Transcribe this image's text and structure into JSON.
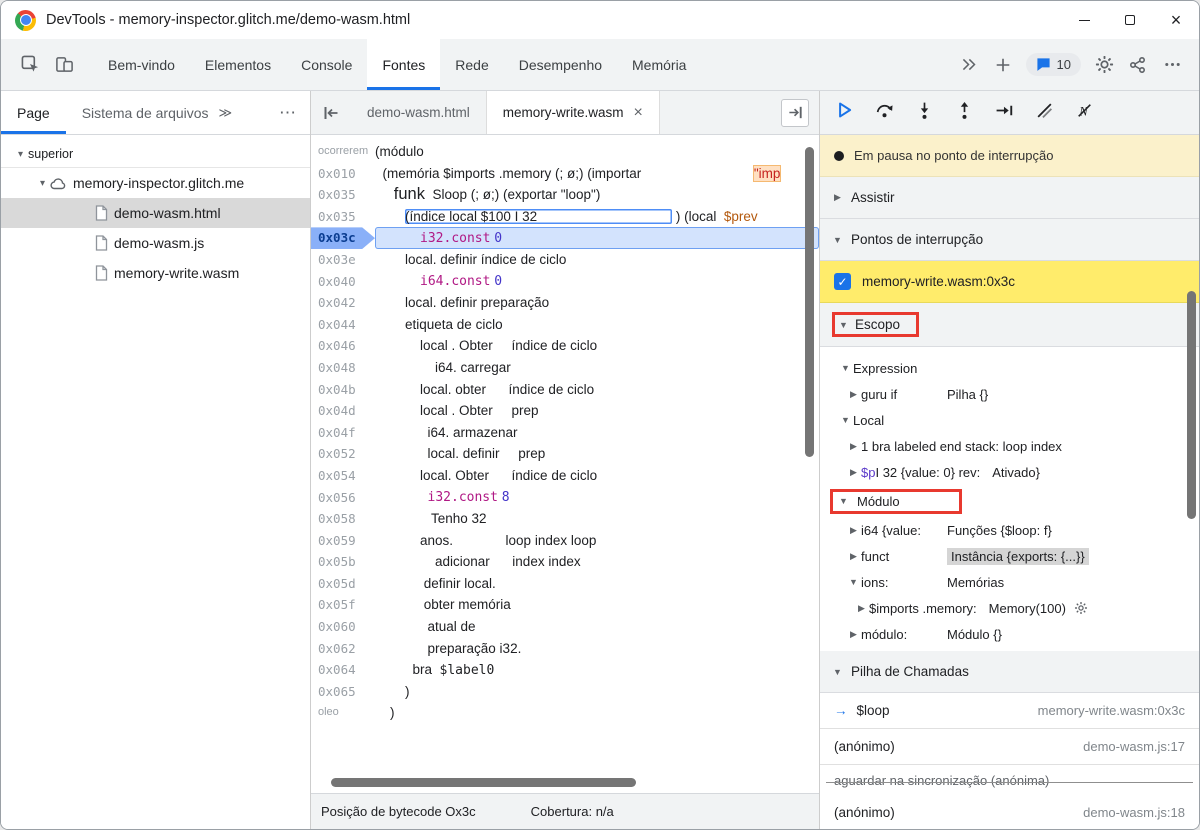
{
  "window": {
    "title": "DevTools - memory-inspector.glitch.me/demo-wasm.html"
  },
  "main_toolbar": {
    "tabs": [
      {
        "label": "Bem-vindo",
        "active": false
      },
      {
        "label": "Elementos",
        "active": false
      },
      {
        "label": "Console",
        "active": false
      },
      {
        "label": "Fontes",
        "active": true
      },
      {
        "label": "Rede",
        "active": false
      },
      {
        "label": "Desempenho",
        "active": false
      },
      {
        "label": "Memória",
        "active": false
      }
    ],
    "more_tabs_glyph": "≫",
    "issues_count": "10",
    "left_icons": [
      "inspect-icon",
      "device-toolbar-icon"
    ],
    "right_icons": [
      "more-tabs-icon",
      "add-tab-icon",
      "issues-icon",
      "settings-icon",
      "profiles-icon",
      "overflow-menu-icon"
    ]
  },
  "left_panel": {
    "tabs": [
      {
        "label": "Page",
        "active": true
      },
      {
        "label": "Sistema de arquivos",
        "active": false
      }
    ],
    "overflow_glyph": "≫",
    "more_glyph": "⋯",
    "tree": [
      {
        "label": "superior",
        "level": 0,
        "expander": "open",
        "icon": null,
        "selected": false
      },
      {
        "label": "memory-inspector.glitch.me",
        "level": 1,
        "expander": "open",
        "icon": "cloud",
        "selected": false
      },
      {
        "label": "demo-wasm.html",
        "level": 2,
        "expander": null,
        "icon": "file",
        "selected": true
      },
      {
        "label": "demo-wasm.js",
        "level": 2,
        "expander": null,
        "icon": "file",
        "selected": false
      },
      {
        "label": "memory-write.wasm",
        "level": 2,
        "expander": null,
        "icon": "file",
        "selected": false
      }
    ]
  },
  "editor": {
    "tabs": [
      {
        "label": "demo-wasm.html",
        "active": false,
        "closable": false
      },
      {
        "label": "memory-write.wasm",
        "active": true,
        "closable": true
      }
    ],
    "status_left": "Posição de bytecode Ox3c",
    "status_right": "Cobertura: n/a",
    "lines": [
      {
        "a": "ocorrerem",
        "seg": [
          [
            "t",
            "(módulo"
          ]
        ]
      },
      {
        "a": "0x010",
        "seg": [
          [
            "t",
            "  (memória $imports .memory (; ø;) (importar"
          ],
          [
            "t",
            "                              "
          ],
          [
            "str",
            "\"imp"
          ]
        ]
      },
      {
        "a": "0x035",
        "seg": [
          [
            "t",
            "     "
          ],
          [
            "big",
            "funk"
          ],
          [
            "t",
            "  Sloop (; ø;) (exportar \"loop\")"
          ]
        ]
      },
      {
        "a": "0x035",
        "seg": [
          [
            "t",
            "        "
          ],
          [
            "boxed",
            "(índice local $100 I 32                                    "
          ],
          [
            "t",
            " ) (local  "
          ],
          [
            "var",
            "$prev"
          ]
        ]
      },
      {
        "a": "0x03c",
        "cur": true,
        "seg": [
          [
            "t",
            "            "
          ],
          [
            "kw",
            "i32.const"
          ],
          [
            "t",
            " "
          ],
          [
            "num",
            "0"
          ]
        ]
      },
      {
        "a": "0x03e",
        "seg": [
          [
            "t",
            "        local. definir índice de ciclo"
          ]
        ]
      },
      {
        "a": "0x040",
        "seg": [
          [
            "t",
            "            "
          ],
          [
            "kw",
            "i64.const"
          ],
          [
            "t",
            " "
          ],
          [
            "num",
            "0"
          ]
        ]
      },
      {
        "a": "0x042",
        "seg": [
          [
            "t",
            "        local. definir preparação"
          ]
        ]
      },
      {
        "a": "0x044",
        "seg": [
          [
            "t",
            "        etiqueta de ciclo"
          ]
        ]
      },
      {
        "a": "0x046",
        "seg": [
          [
            "t",
            "            local . Obter     índice de ciclo"
          ]
        ]
      },
      {
        "a": "0x048",
        "seg": [
          [
            "t",
            "                i64. carregar"
          ]
        ]
      },
      {
        "a": "0x04b",
        "seg": [
          [
            "t",
            "            local. obter      índice de ciclo"
          ]
        ]
      },
      {
        "a": "0x04d",
        "seg": [
          [
            "t",
            "            local . Obter     prep"
          ]
        ]
      },
      {
        "a": "0x04f",
        "seg": [
          [
            "t",
            "              i64. armazenar"
          ]
        ]
      },
      {
        "a": "0x052",
        "seg": [
          [
            "t",
            "              local. definir     prep"
          ]
        ]
      },
      {
        "a": "0x054",
        "seg": [
          [
            "t",
            "            local. Obter      índice de ciclo"
          ]
        ]
      },
      {
        "a": "0x056",
        "seg": [
          [
            "t",
            "              "
          ],
          [
            "kw",
            "i32.const"
          ],
          [
            "t",
            " "
          ],
          [
            "num",
            "8"
          ]
        ]
      },
      {
        "a": "0x058",
        "seg": [
          [
            "t",
            "               Tenho 32"
          ]
        ]
      },
      {
        "a": "0x059",
        "seg": [
          [
            "t",
            "            anos.              loop index loop"
          ]
        ]
      },
      {
        "a": "0x05b",
        "seg": [
          [
            "t",
            "                adicionar      index index"
          ]
        ]
      },
      {
        "a": "0x05d",
        "seg": [
          [
            "t",
            "             definir local."
          ]
        ]
      },
      {
        "a": "0x05f",
        "seg": [
          [
            "t",
            "             obter memória"
          ]
        ]
      },
      {
        "a": "0x060",
        "seg": [
          [
            "t",
            "              atual de"
          ]
        ]
      },
      {
        "a": "0x062",
        "seg": [
          [
            "t",
            "              preparação i32."
          ]
        ]
      },
      {
        "a": "0x064",
        "seg": [
          [
            "t",
            "          bra  "
          ],
          [
            "mono",
            "$label0"
          ]
        ]
      },
      {
        "a": "0x065",
        "seg": [
          [
            "t",
            "        )"
          ]
        ]
      },
      {
        "a": "oleo",
        "seg": [
          [
            "t",
            "    )"
          ]
        ]
      }
    ]
  },
  "debugger": {
    "toolbar_icons": [
      "resume-icon",
      "step-over-icon",
      "step-into-icon",
      "step-out-icon",
      "step-icon",
      "deactivate-breakpoints-icon",
      "ignore-list-icon"
    ],
    "paused_message": "Em pausa no ponto de interrupção",
    "sections": {
      "watch": "Assistir",
      "breakpoints": "Pontos de interrupção",
      "scope": "Escopo",
      "call_stack": "Pilha de Chamadas"
    },
    "breakpoints": [
      {
        "label": "memory-write.wasm:0x3c",
        "checked": true
      }
    ],
    "scope": [
      {
        "exp": "open",
        "ind": 1,
        "name": [
          [
            "t",
            "Expression"
          ]
        ]
      },
      {
        "exp": "closed",
        "ind": 2,
        "name": [
          [
            "t",
            "guru if"
          ]
        ],
        "value": [
          [
            "t",
            "Pilha {}"
          ]
        ]
      },
      {
        "exp": "open",
        "ind": 1,
        "name": [
          [
            "t",
            "Local"
          ]
        ]
      },
      {
        "exp": "closed",
        "ind": 2,
        "name": [
          [
            "t",
            "1 bra labeled end stack: loop index"
          ]
        ]
      },
      {
        "exp": "closed",
        "ind": 2,
        "name": [
          [
            "var",
            "$p"
          ],
          [
            "t",
            "I 32 {value: 0} rev:"
          ]
        ],
        "value": [
          [
            "t",
            "Ativado}"
          ]
        ]
      },
      {
        "exp": "open",
        "ind": 0,
        "name": [
          [
            "t",
            "Módulo"
          ]
        ],
        "redbox": true
      },
      {
        "exp": "closed",
        "ind": 2,
        "name": [
          [
            "t",
            "i64 {value:"
          ]
        ],
        "value": [
          [
            "t",
            "Funções {$loop: f}"
          ]
        ]
      },
      {
        "exp": "closed",
        "ind": 2,
        "name": [
          [
            "t",
            "funct"
          ]
        ],
        "value": [
          [
            "hl",
            "Instância {exports: {...}}"
          ]
        ]
      },
      {
        "exp": "open",
        "ind": 2,
        "name": [
          [
            "t",
            "ions:"
          ]
        ],
        "value": [
          [
            "t",
            "Memórias"
          ]
        ]
      },
      {
        "exp": "closed",
        "ind": 3,
        "name": [
          [
            "t",
            "$imports .memory:"
          ]
        ],
        "value": [
          [
            "t",
            "Memory(100)"
          ]
        ],
        "gear": true
      },
      {
        "exp": "closed",
        "ind": 2,
        "name": [
          [
            "t",
            "módulo:"
          ]
        ],
        "value": [
          [
            "t",
            "Módulo {}"
          ]
        ]
      }
    ],
    "call_stack": [
      {
        "name": "$loop",
        "location": "memory-write.wasm:0x3c",
        "current": true
      },
      {
        "name": "(anónimo)",
        "location": "demo-wasm.js:17"
      },
      {
        "name": "aguardar na sincronização (anónima)",
        "async": true
      },
      {
        "name": "(anónimo)",
        "location": "demo-wasm.js:18"
      }
    ]
  }
}
